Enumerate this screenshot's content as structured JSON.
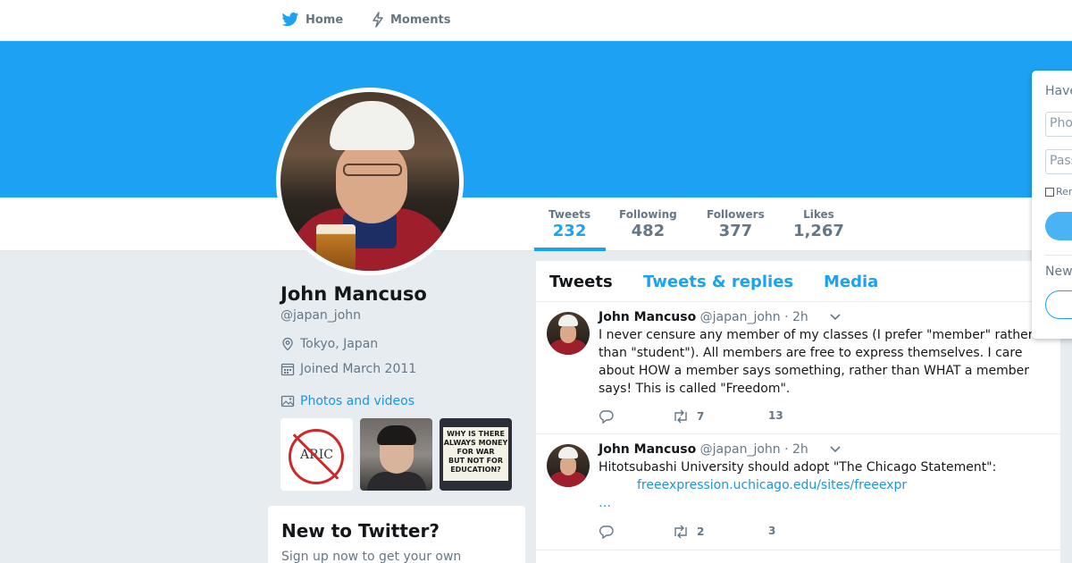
{
  "nav": {
    "home_label": "Home",
    "moments_label": "Moments"
  },
  "colors": {
    "brand_blue": "#1da1f2",
    "link_blue": "#1b95e0",
    "muted_gray": "#657786"
  },
  "stats": [
    {
      "label": "Tweets",
      "value": "232",
      "active": true
    },
    {
      "label": "Following",
      "value": "482"
    },
    {
      "label": "Followers",
      "value": "377"
    },
    {
      "label": "Likes",
      "value": "1,267"
    }
  ],
  "profile": {
    "name": "John Mancuso",
    "handle": "@japan_john",
    "location": "Tokyo, Japan",
    "joined": "Joined March 2011",
    "photos_link": "Photos and videos",
    "thumb1_text": "ARIC",
    "thumb3_text": "WHY IS THERE\nALWAYS MONEY\nFOR WAR\nBUT NOT FOR\nEDUCATION?"
  },
  "signup_box": {
    "title": "New to Twitter?",
    "text": "Sign up now to get your own"
  },
  "timeline": {
    "tabs": [
      "Tweets",
      "Tweets & replies",
      "Media"
    ],
    "tweets": [
      {
        "name": "John Mancuso",
        "handle": "@japan_john",
        "time": "· 2h",
        "text": "I never censure any member of my classes (I prefer \"member\" rather than \"student\"). All members are free to express themselves. I care about HOW a member says something, rather than WHAT a member says! This is called \"Freedom\".",
        "retweets": "7",
        "likes": "13"
      },
      {
        "name": "John Mancuso",
        "handle": "@japan_john",
        "time": "· 2h",
        "text": "Hitotsubashi University should adopt \"The Chicago Statement\":",
        "link": "freeexpression.uchicago.edu/sites/freeexpr",
        "link_more": "…",
        "retweets": "2",
        "likes": "3"
      }
    ]
  },
  "login": {
    "title": "Have an account?",
    "phone_placeholder": "Phone, email or username",
    "password_placeholder": "Password",
    "remember": "Remember me",
    "new_question": "New to Twitter?"
  }
}
